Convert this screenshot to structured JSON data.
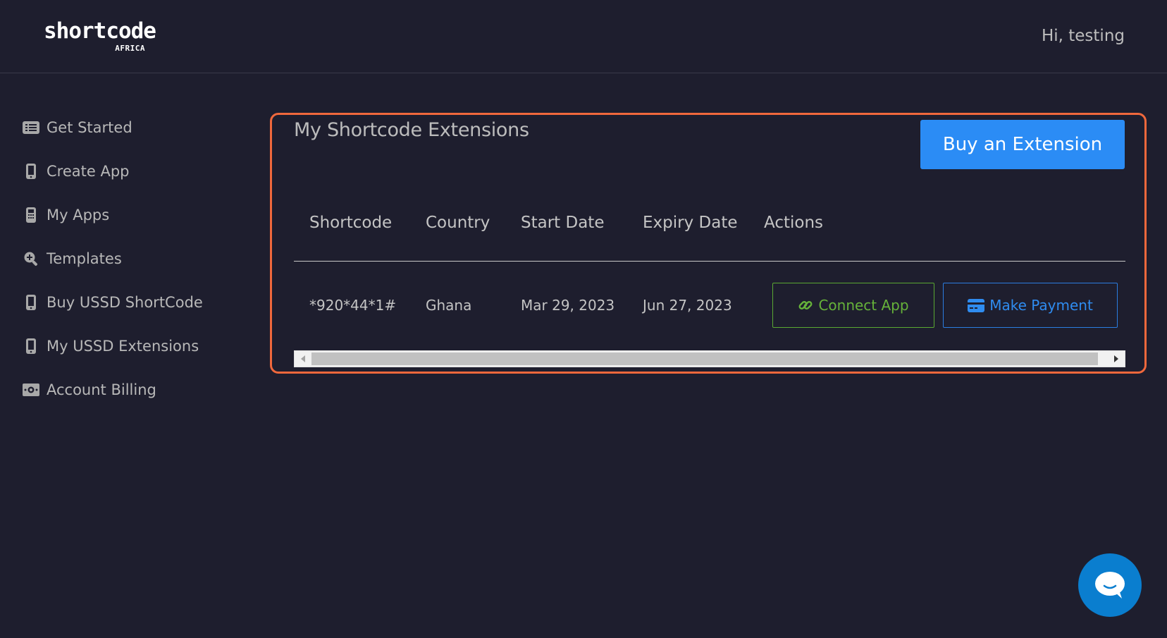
{
  "header": {
    "logo_main": "shortcode",
    "logo_sub": "AFRICA",
    "greeting": "Hi, testing"
  },
  "sidebar": {
    "items": [
      {
        "label": "Get Started",
        "icon": "list-icon"
      },
      {
        "label": "Create App",
        "icon": "mobile-icon"
      },
      {
        "label": "My Apps",
        "icon": "calculator-icon"
      },
      {
        "label": "Templates",
        "icon": "search-plus-icon"
      },
      {
        "label": "Buy USSD ShortCode",
        "icon": "mobile-icon"
      },
      {
        "label": "My USSD Extensions",
        "icon": "mobile-icon"
      },
      {
        "label": "Account Billing",
        "icon": "money-bill-icon"
      }
    ]
  },
  "main": {
    "title": "My Shortcode Extensions",
    "buy_button": "Buy an Extension",
    "table": {
      "headers": [
        "Shortcode",
        "Country",
        "Start Date",
        "Expiry Date",
        "Actions"
      ],
      "rows": [
        {
          "shortcode": "*920*44*1#",
          "country": "Ghana",
          "start_date": "Mar 29, 2023",
          "expiry_date": "Jun 27, 2023",
          "connect_label": "Connect App",
          "payment_label": "Make Payment"
        }
      ]
    }
  },
  "colors": {
    "background": "#1e1e2e",
    "accent_border": "#f0683c",
    "primary_button": "#2b8cf5",
    "connect_green": "#66b23a",
    "payment_blue": "#2f8cf0",
    "chat_blue": "#0a7ecf"
  },
  "chat": {
    "icon": "chat-bubble-icon"
  }
}
